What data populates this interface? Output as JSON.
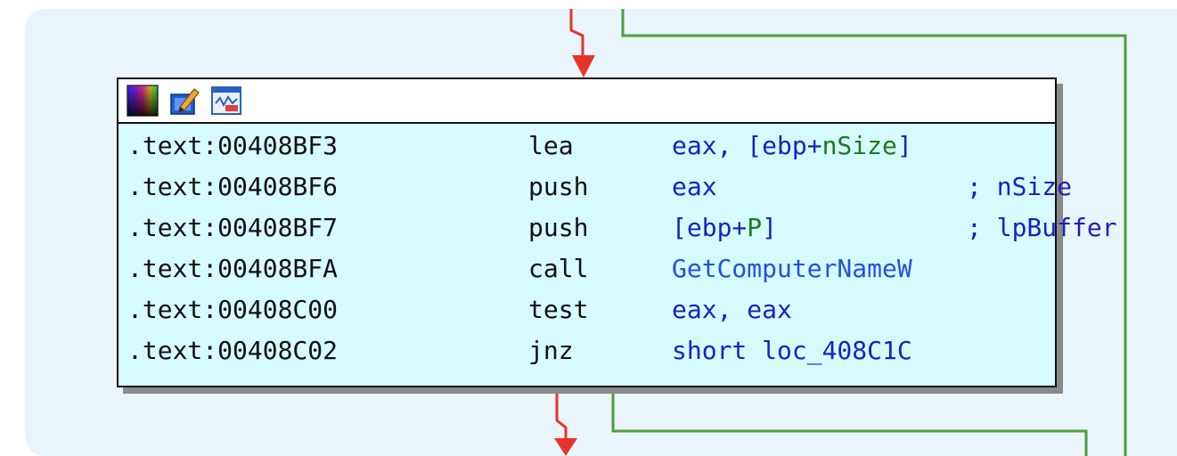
{
  "colors": {
    "background": "#eaf5fb",
    "node_fill": "#d6fbff",
    "edge_false": "#e8332b",
    "edge_true": "#4f9d3a",
    "operand": "#1b1fc2",
    "local_var": "#1a7a1a",
    "api_name": "#2251e0"
  },
  "header_icons": [
    "node-color-icon",
    "edit-node-icon",
    "graph-layout-icon"
  ],
  "lines": [
    {
      "addr": ".text:00408BF3",
      "mnem": "lea",
      "ops": [
        {
          "t": "eax, [ebp+",
          "k": "plain"
        },
        {
          "t": "nSize",
          "k": "var"
        },
        {
          "t": "]",
          "k": "plain"
        }
      ],
      "cmt": ""
    },
    {
      "addr": ".text:00408BF6",
      "mnem": "push",
      "ops": [
        {
          "t": "eax",
          "k": "plain"
        }
      ],
      "cmt": "; nSize"
    },
    {
      "addr": ".text:00408BF7",
      "mnem": "push",
      "ops": [
        {
          "t": "[ebp+",
          "k": "plain"
        },
        {
          "t": "P",
          "k": "var"
        },
        {
          "t": "]",
          "k": "plain"
        }
      ],
      "cmt": "; lpBuffer"
    },
    {
      "addr": ".text:00408BFA",
      "mnem": "call",
      "ops": [
        {
          "t": "GetComputerNameW",
          "k": "api"
        }
      ],
      "cmt": ""
    },
    {
      "addr": ".text:00408C00",
      "mnem": "test",
      "ops": [
        {
          "t": "eax, eax",
          "k": "plain"
        }
      ],
      "cmt": ""
    },
    {
      "addr": ".text:00408C02",
      "mnem": "jnz",
      "ops": [
        {
          "t": "short loc_408C1C",
          "k": "plain"
        }
      ],
      "cmt": ""
    }
  ]
}
